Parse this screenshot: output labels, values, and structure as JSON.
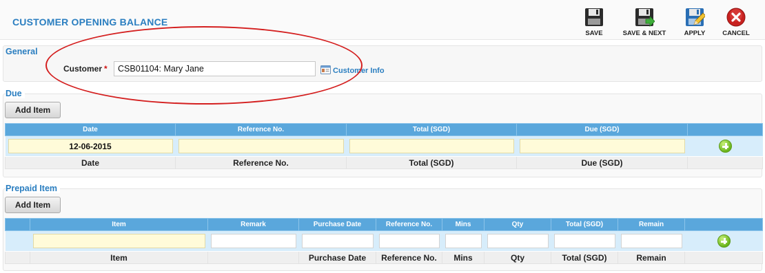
{
  "header": {
    "title": "CUSTOMER OPENING BALANCE",
    "toolbar": {
      "save": "SAVE",
      "save_next": "SAVE & NEXT",
      "apply": "APPLY",
      "cancel": "CANCEL"
    }
  },
  "general": {
    "title": "General",
    "customer_label": "Customer",
    "required_mark": "*",
    "customer_value": "CSB01104: Mary Jane",
    "customer_info_link": "Customer Info"
  },
  "due": {
    "title": "Due",
    "add_item_label": "Add Item",
    "columns": [
      "Date",
      "Reference No.",
      "Total (SGD)",
      "Due (SGD)"
    ],
    "row": {
      "date": "12-06-2015",
      "reference": "",
      "total": "",
      "due": ""
    },
    "footer": [
      "Date",
      "Reference No.",
      "Total (SGD)",
      "Due (SGD)"
    ]
  },
  "prepaid": {
    "title": "Prepaid Item",
    "add_item_label": "Add Item",
    "columns": [
      "Item",
      "Remark",
      "Purchase Date",
      "Reference No.",
      "Mins",
      "Qty",
      "Total (SGD)",
      "Remain"
    ],
    "footer": [
      "Item",
      "Purchase Date",
      "Reference No.",
      "Mins",
      "Qty",
      "Total (SGD)",
      "Remain"
    ]
  },
  "colors": {
    "accent": "#2a7ec0",
    "table_header": "#5aa7dc",
    "input_row": "#d7edfb",
    "annotation": "#d41f1f"
  },
  "icons": [
    "floppy-disk-icon",
    "floppy-disk-arrow-icon",
    "floppy-disk-pencil-icon",
    "cancel-x-icon",
    "customer-card-icon",
    "add-row-plus-icon"
  ]
}
